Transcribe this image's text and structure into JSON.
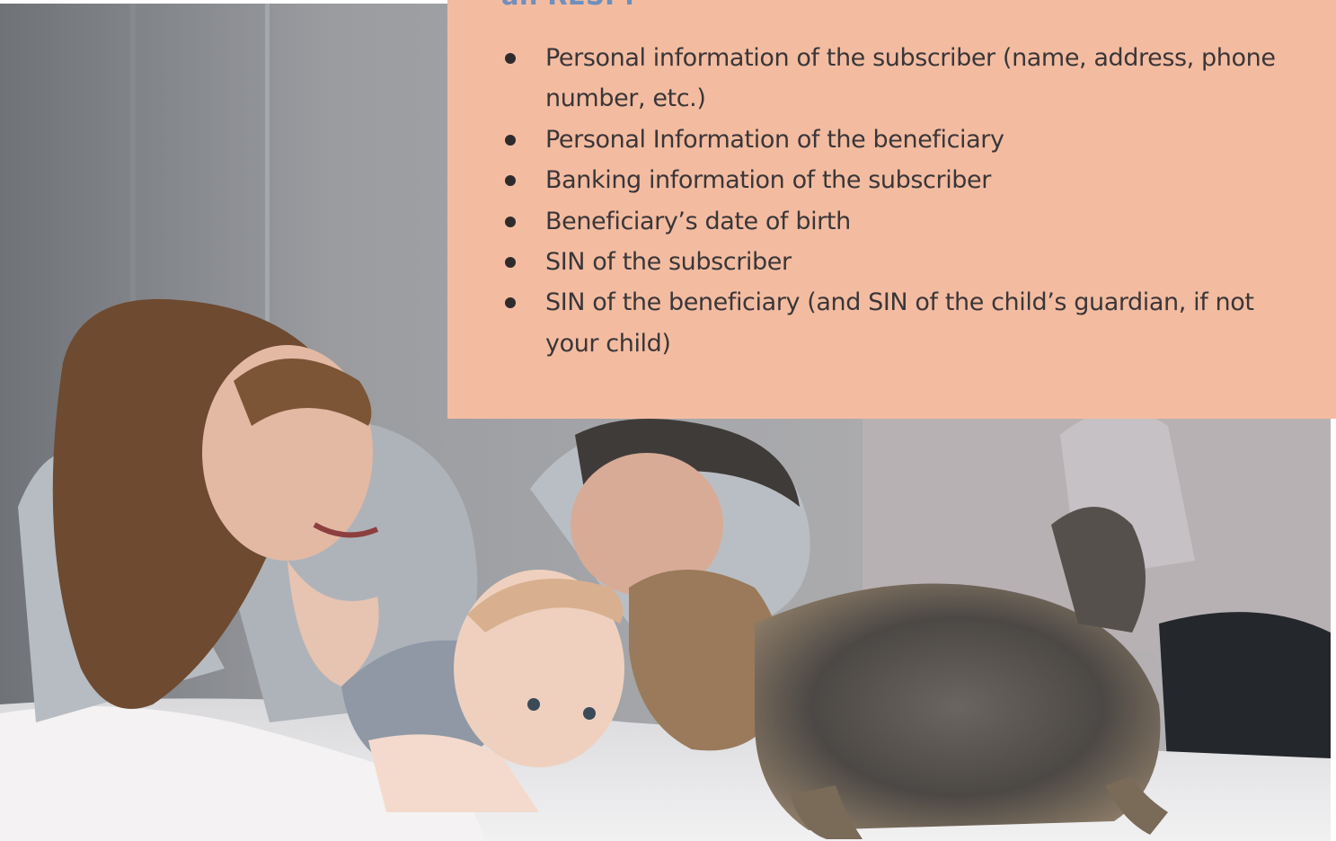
{
  "card": {
    "heading": "an RESP:",
    "items": [
      "Personal information of the subscriber (name, address, phone number, etc.)",
      "Personal Information of the beneficiary",
      "Banking information of the subscriber",
      "Beneficiary’s date of birth",
      "SIN of the subscriber",
      "SIN of the beneficiary (and SIN of the child’s guardian, if not your child)"
    ]
  },
  "colors": {
    "card_background": "#f3bca1",
    "heading": "#6f8fbd",
    "body_text": "#3a3638"
  },
  "image": {
    "subject": "family-photo"
  }
}
